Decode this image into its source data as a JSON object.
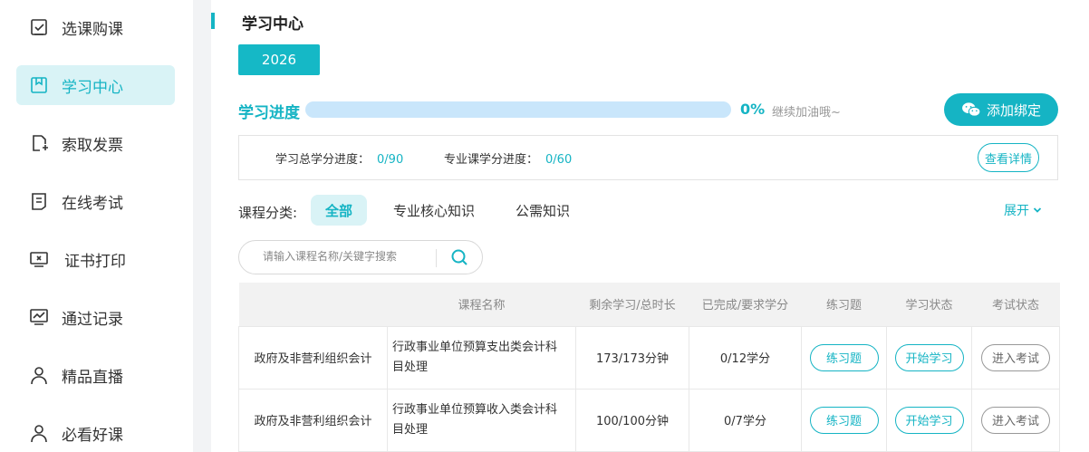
{
  "sidebar": {
    "items": [
      {
        "label": "选课购课",
        "icon": "checkbox-icon"
      },
      {
        "label": "学习中心",
        "icon": "bookmark-icon"
      },
      {
        "label": "索取发票",
        "icon": "invoice-icon"
      },
      {
        "label": "在线考试",
        "icon": "exam-icon"
      },
      {
        "label": "证书打印",
        "icon": "certificate-icon"
      },
      {
        "label": "通过记录",
        "icon": "chart-icon"
      },
      {
        "label": "精品直播",
        "icon": "user-icon"
      },
      {
        "label": "必看好课",
        "icon": "user-icon"
      }
    ],
    "active_index": 1
  },
  "main": {
    "title": "学习中心",
    "year_tab": "2026",
    "progress": {
      "label": "学习进度",
      "percent_text": "0%",
      "fraction": 0,
      "hint": "继续加油哦~"
    },
    "bind_button": "添加绑定",
    "credits": {
      "total_label": "学习总学分进度：",
      "total_value": "0/90",
      "major_label": "专业课学分进度：",
      "major_value": "0/60",
      "detail_button": "查看详情"
    },
    "category": {
      "label": "课程分类:",
      "tabs": [
        "全部",
        "专业核心知识",
        "公需知识"
      ],
      "active_index": 0,
      "expand": "展开"
    },
    "search": {
      "placeholder": "请输入课程名称/关键字搜索"
    },
    "table": {
      "headers": [
        "",
        "课程名称",
        "剩余学习/总时长",
        "已完成/要求学分",
        "练习题",
        "学习状态",
        "考试状态"
      ],
      "rows": [
        {
          "category": "政府及非营利组织会计",
          "name": "行政事业单位预算支出类会计科目处理",
          "remaining": "173/173分钟",
          "credits": "0/12学分",
          "practice": "练习题",
          "study": "开始学习",
          "exam": "进入考试"
        },
        {
          "category": "政府及非营利组织会计",
          "name": "行政事业单位预算收入类会计科目处理",
          "remaining": "100/100分钟",
          "credits": "0/7学分",
          "practice": "练习题",
          "study": "开始学习",
          "exam": "进入考试"
        }
      ]
    }
  },
  "colors": {
    "accent": "#15b4c4",
    "active_bg": "#d9f3f6",
    "progress_track": "#c9e6fb"
  }
}
